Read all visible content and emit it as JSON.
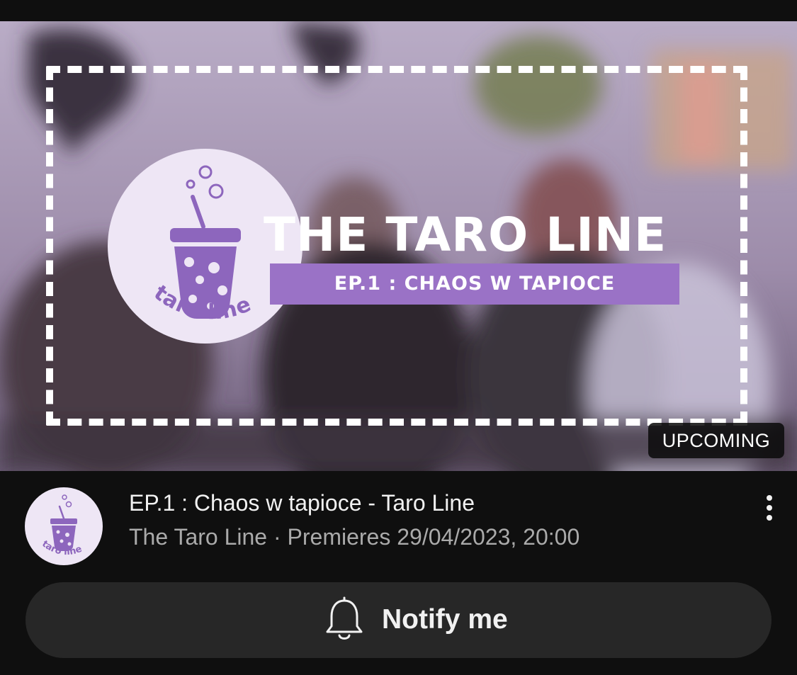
{
  "thumbnail": {
    "logo_text": "taro line",
    "show_title": "THE TARO LINE",
    "episode_banner": "EP.1 : CHAOS W TAPIOCE",
    "status_badge": "UPCOMING",
    "accent_color": "#9a72c6"
  },
  "video": {
    "title": "EP.1 : Chaos w tapioce - Taro Line",
    "channel": "The Taro Line",
    "separator": "·",
    "premiere_text": "Premieres 29/04/2023, 20:00",
    "meta_line": "The Taro Line · Premieres 29/04/2023, 20:00",
    "menu_icon": "more-vert-icon"
  },
  "notify_button": {
    "label": "Notify me",
    "icon": "bell-icon"
  }
}
